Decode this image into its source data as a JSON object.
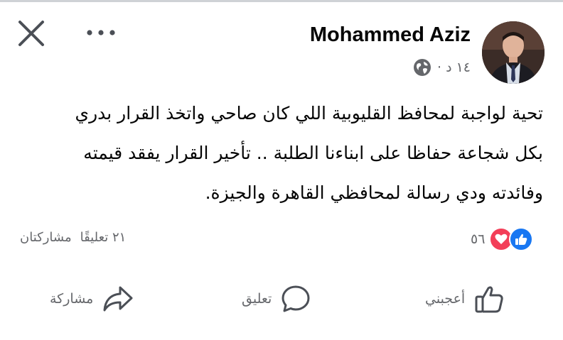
{
  "post": {
    "author": "Mohammed Aziz",
    "timestamp": "١٤ د ·",
    "privacy_icon": "globe-icon",
    "text_lines": [
      "تحية لواجبة لمحافظ القليوبية اللي كان صاحي واتخذ القرار بدري",
      "بكل شجاعة حفاظا على ابناءنا الطلبة .. تأخير القرار  يفقد قيمته",
      "وفائدته ودي رسالة لمحافظي القاهرة والجيزة."
    ]
  },
  "stats": {
    "reaction_count": "٥٦",
    "comments": "٢١ تعليقًا",
    "shares": "مشاركتان"
  },
  "actions": {
    "like": "أعجبني",
    "comment": "تعليق",
    "share": "مشاركة"
  },
  "colors": {
    "like_blue": "#1877f2",
    "love_red": "#f33e58",
    "secondary_text": "#65676b"
  }
}
